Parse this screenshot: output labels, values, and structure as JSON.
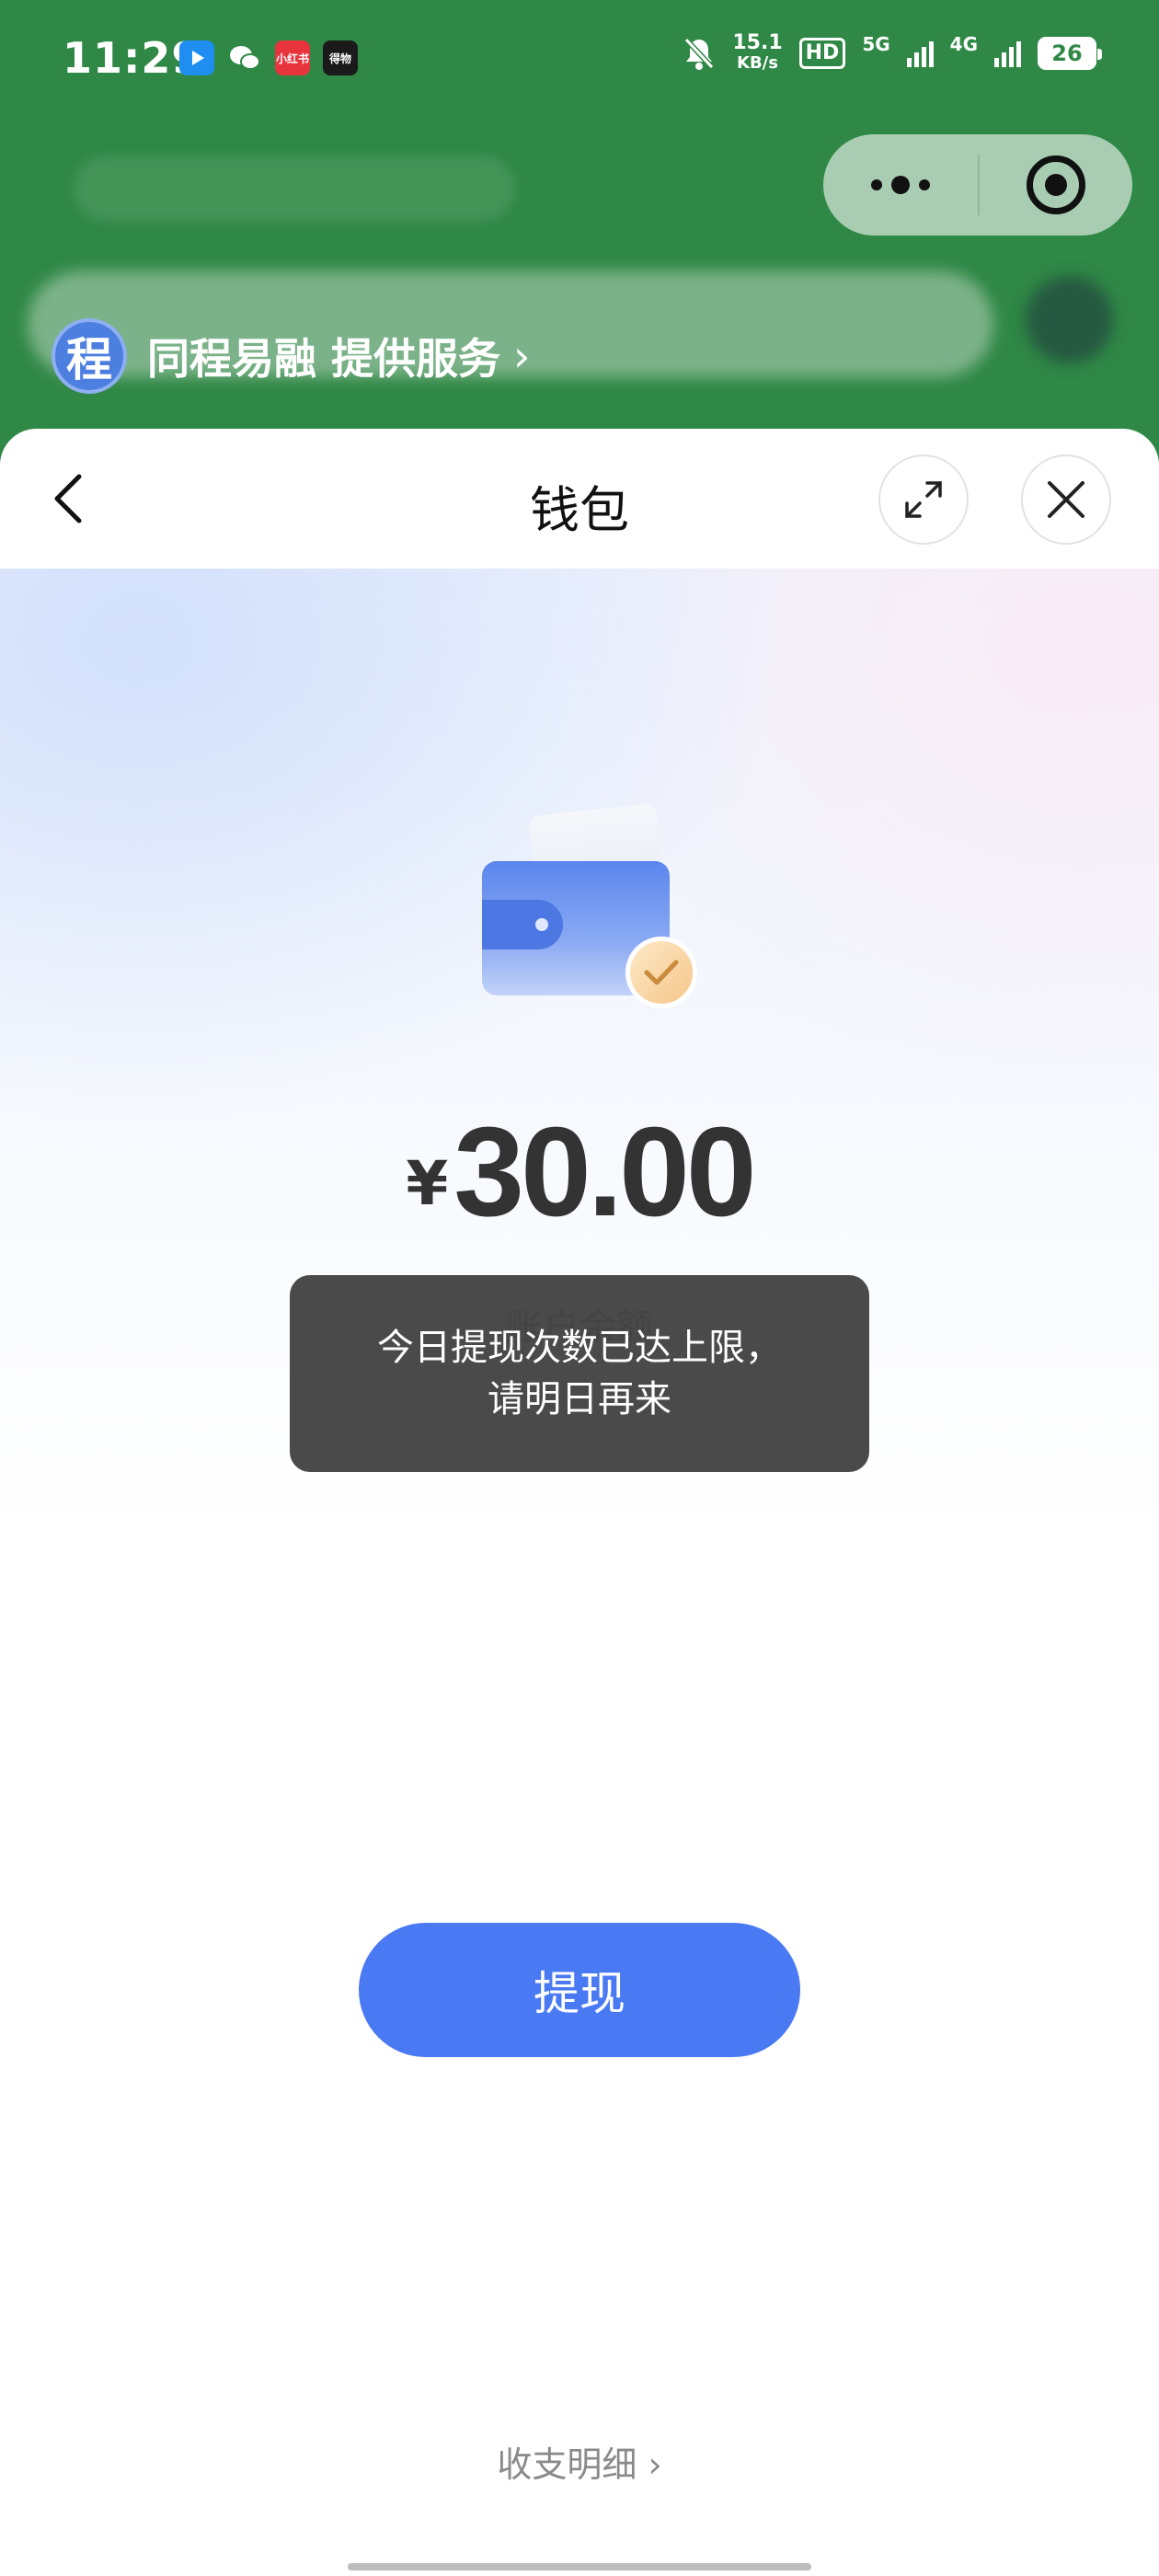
{
  "status_bar": {
    "time": "11:29",
    "app_icons": [
      {
        "name": "video-app-icon",
        "color": "#1e8ef0",
        "label": ""
      },
      {
        "name": "wechat-icon",
        "color": "#2f8846",
        "label": ""
      },
      {
        "name": "xiaohongshu-icon",
        "color": "#e8343d",
        "label": "小红书"
      },
      {
        "name": "dewu-icon",
        "color": "#1a1a1a",
        "label": "得物"
      }
    ],
    "net_speed_value": "15.1",
    "net_speed_unit": "KB/s",
    "hd_label": "HD",
    "sim_5g": "5G",
    "sim_4g": "4G",
    "battery": "26"
  },
  "mini_program": {
    "provider_logo": "程",
    "provider_text": "同程易融 提供服务",
    "provider_chevron": "›"
  },
  "sheet": {
    "title": "钱包"
  },
  "wallet": {
    "currency_symbol": "¥",
    "balance": "30.00",
    "balance_label": "账户余额"
  },
  "toast": {
    "line1": "今日提现次数已达上限，",
    "line2": "请明日再来"
  },
  "actions": {
    "withdraw_label": "提现",
    "details_label": "收支明细 ›"
  },
  "colors": {
    "accent": "#4a79f4",
    "header_green": "#2f8846",
    "toast_bg": "#444444"
  }
}
